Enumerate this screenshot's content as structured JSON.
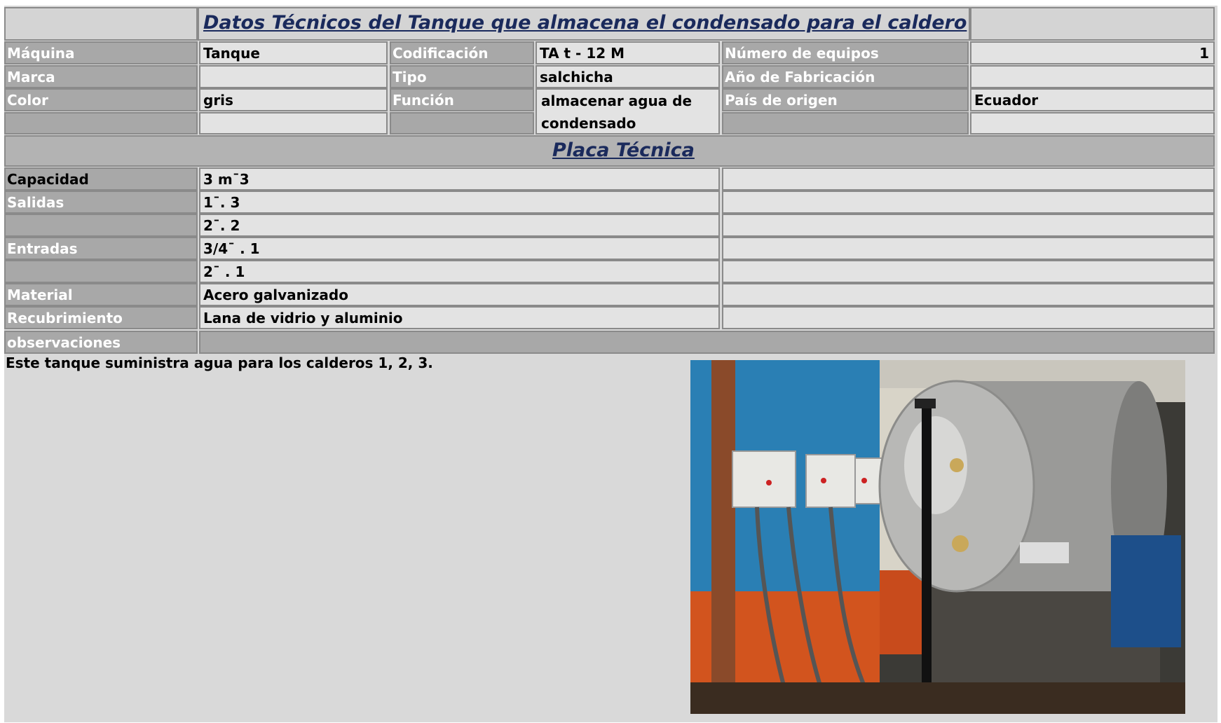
{
  "header": {
    "title": "Datos Técnicos del Tanque que almacena el condensado para el caldero"
  },
  "general": {
    "maquina_label": "Máquina",
    "maquina_value": "Tanque",
    "codificacion_label": "Codificación",
    "codificacion_value": "TA t - 12 M",
    "numero_equipos_label": "Número de equipos",
    "numero_equipos_value": "1",
    "marca_label": "Marca",
    "marca_value": "",
    "tipo_label": "Tipo",
    "tipo_value": "salchicha",
    "anio_label": "Año de Fabricación",
    "anio_value": "",
    "color_label": "Color",
    "color_value": "gris",
    "funcion_label": "Función",
    "funcion_value": "almacenar agua de condensado",
    "pais_label": "País de origen",
    "pais_value": "Ecuador"
  },
  "placa": {
    "title": "Placa  Técnica",
    "rows": [
      {
        "label": "Capacidad",
        "value": "3 m¯3"
      },
      {
        "label": "Salidas",
        "value": "1¯. 3"
      },
      {
        "label": "",
        "value": "2¯. 2"
      },
      {
        "label": "Entradas",
        "value": "3/4¯ . 1"
      },
      {
        "label": "",
        "value": "2¯ . 1"
      },
      {
        "label": "Material",
        "value": "Acero galvanizado"
      },
      {
        "label": "Recubrimiento",
        "value": "Lana de vidrio y aluminio"
      }
    ],
    "observaciones_label": "observaciones",
    "observaciones_text": "Este tanque suministra agua para los calderos 1, 2, 3."
  },
  "colors": {
    "label_bg": "#a8a8a8",
    "value_bg": "#e3e3e3",
    "title_color": "#1a2a5c"
  }
}
